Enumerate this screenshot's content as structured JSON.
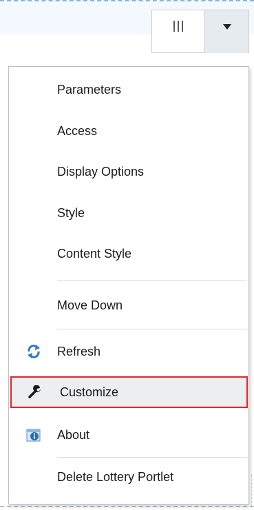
{
  "toolbar": {
    "columns_icon": "columns-icon",
    "dropdown_icon": "caret-down-icon"
  },
  "menu": {
    "items": [
      {
        "label": "Parameters",
        "icon": null
      },
      {
        "label": "Access",
        "icon": null
      },
      {
        "label": "Display Options",
        "icon": null
      },
      {
        "label": "Style",
        "icon": null
      },
      {
        "label": "Content Style",
        "icon": null
      },
      {
        "label": "Move Down",
        "icon": null
      },
      {
        "label": "Refresh",
        "icon": "refresh-icon"
      },
      {
        "label": "Customize",
        "icon": "wrench-icon",
        "highlighted": true
      },
      {
        "label": "About",
        "icon": "info-icon"
      },
      {
        "label": "Delete Lottery Portlet",
        "icon": null
      }
    ]
  },
  "colors": {
    "highlight_border": "#e3252b",
    "highlight_bg": "#eceeef",
    "refresh_icon": "#2f7bc2",
    "info_icon": "#2a6fb3"
  }
}
